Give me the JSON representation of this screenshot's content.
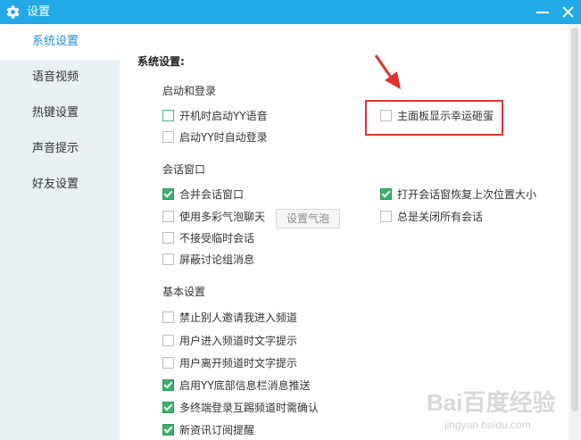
{
  "window": {
    "title": "设置"
  },
  "sidebar": {
    "items": [
      {
        "label": "系统设置"
      },
      {
        "label": "语音视频"
      },
      {
        "label": "热键设置"
      },
      {
        "label": "声音提示"
      },
      {
        "label": "好友设置"
      }
    ]
  },
  "main": {
    "heading": "系统设置:",
    "sections": {
      "startup": {
        "title": "启动和登录",
        "options": [
          {
            "label": "开机时启动YY语音",
            "checked": false
          },
          {
            "label": "启动YY时自动登录",
            "checked": false
          },
          {
            "label": "主面板显示幸运砸蛋",
            "checked": false
          }
        ]
      },
      "chat": {
        "title": "会话窗口",
        "options": [
          {
            "label": "合并会话窗口",
            "checked": true
          },
          {
            "label": "使用多彩气泡聊天",
            "checked": false
          },
          {
            "label": "不接受临时会话",
            "checked": false
          },
          {
            "label": "屏蔽讨论组消息",
            "checked": false
          },
          {
            "label": "打开会话窗恢复上次位置大小",
            "checked": true
          },
          {
            "label": "总是关闭所有会话",
            "checked": false
          }
        ],
        "bubble_button": "设置气泡"
      },
      "basic": {
        "title": "基本设置",
        "options": [
          {
            "label": "禁止别人邀请我进入频道",
            "checked": false
          },
          {
            "label": "用户进入频道时文字提示",
            "checked": false
          },
          {
            "label": "用户离开频道时文字提示",
            "checked": false
          },
          {
            "label": "启用YY底部信息栏消息推送",
            "checked": true
          },
          {
            "label": "多终端登录互踢频道时需确认",
            "checked": true
          },
          {
            "label": "新资讯订阅提醒",
            "checked": true
          }
        ]
      }
    }
  },
  "watermark": {
    "brand": "Bai百度经验",
    "url": "jingyan.baidu.com"
  },
  "colors": {
    "titlebar": "#22a9e8",
    "accent": "#1f93d3",
    "check": "#3bb06c",
    "highlight": "#e0332f"
  },
  "icons": [
    "gear-icon",
    "minimize-icon",
    "close-icon",
    "checkbox-checked-icon",
    "checkbox-unchecked-icon",
    "arrow-icon"
  ]
}
